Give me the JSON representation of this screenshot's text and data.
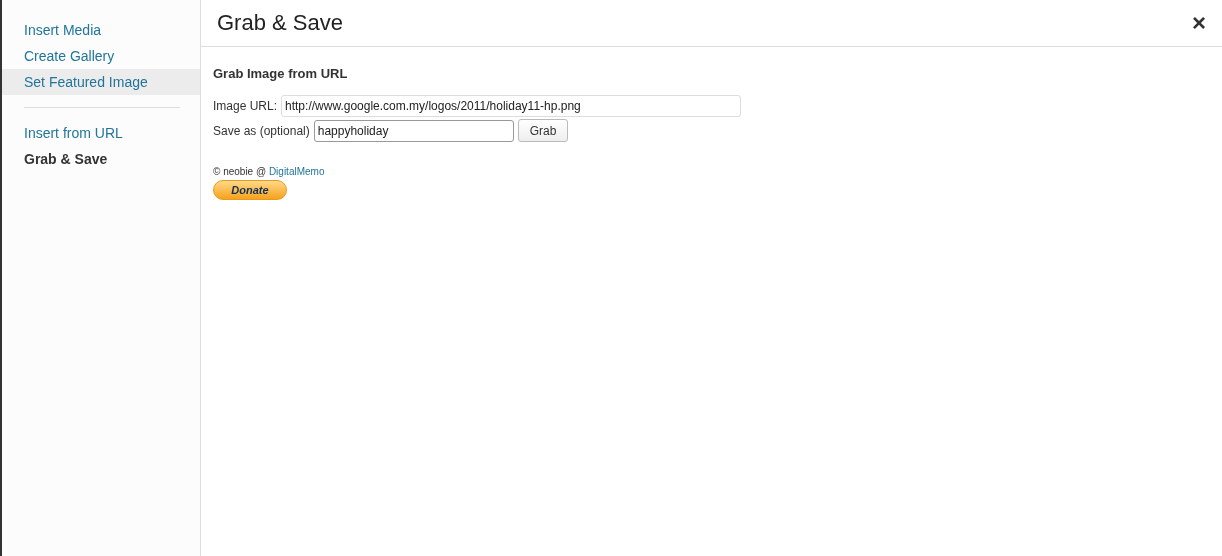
{
  "sidebar": {
    "groups": [
      {
        "items": [
          {
            "label": "Insert Media",
            "selected": false,
            "hovered": false
          },
          {
            "label": "Create Gallery",
            "selected": false,
            "hovered": false
          },
          {
            "label": "Set Featured Image",
            "selected": false,
            "hovered": true
          }
        ]
      },
      {
        "items": [
          {
            "label": "Insert from URL",
            "selected": false,
            "hovered": false
          },
          {
            "label": "Grab & Save",
            "selected": true,
            "hovered": false
          }
        ]
      }
    ]
  },
  "dialog": {
    "title": "Grab & Save",
    "close": "×"
  },
  "form": {
    "heading": "Grab Image from URL",
    "fields": [
      {
        "label": "Image URL:",
        "value": "http://www.google.com.my/logos/2011/holiday11-hp.png",
        "kind": "wide"
      },
      {
        "label": "Save as (optional)",
        "value": "happyholiday",
        "kind": "narrow",
        "button": "Grab"
      }
    ]
  },
  "credit": {
    "text": "© neobie @ ",
    "link": "DigitalMemo"
  },
  "donate": "Donate"
}
